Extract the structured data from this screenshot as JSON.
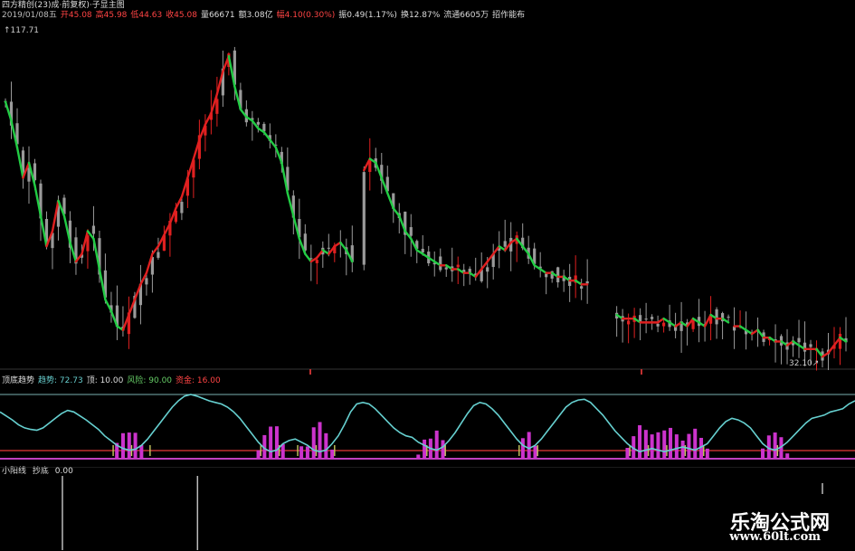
{
  "header": {
    "line1": "四方精创(23)成·前复权)·子显主图",
    "line2": [
      {
        "text": "2019/01/08五",
        "color": "#bbbbbb"
      },
      {
        "text": "开45.08",
        "color": "#ff4444"
      },
      {
        "text": "高45.98",
        "color": "#ff4444"
      },
      {
        "text": "低44.63",
        "color": "#ff4444"
      },
      {
        "text": "收45.08",
        "color": "#ff4444"
      },
      {
        "text": "量66671",
        "color": "#dddddd"
      },
      {
        "text": "额3.08亿",
        "color": "#dddddd"
      },
      {
        "text": "幅4.10(0.30%)",
        "color": "#ff4444"
      },
      {
        "text": "振0.49(1.17%)",
        "color": "#dddddd"
      },
      {
        "text": "换12.87%",
        "color": "#dddddd"
      },
      {
        "text": "流通6605万",
        "color": "#dddddd"
      },
      {
        "text": "招作能布",
        "color": "#dddddd"
      }
    ]
  },
  "main_chart": {
    "max_label": "117.71",
    "min_label": "32.10"
  },
  "osc_panel": {
    "labels": [
      {
        "text": "顶底趋势",
        "color": "#dddddd"
      },
      {
        "text": "趋势: 72.73",
        "color": "#66cccc"
      },
      {
        "text": "顶: 10.00",
        "color": "#dddddd"
      },
      {
        "text": "风险: 90.00",
        "color": "#66cc66"
      },
      {
        "text": "资金: 16.00",
        "color": "#ff4444"
      }
    ]
  },
  "bottom_panel": {
    "title": "小阳线",
    "label": "抄底",
    "value": "0.00"
  },
  "watermark": {
    "line1": "乐淘公式网",
    "line2": "www.60lt.com"
  },
  "colors": {
    "up": "#e02020",
    "down": "#22cc44",
    "candle_gray": "#9a9a9a",
    "osc_line": "#66d0d0",
    "magenta": "#cc33cc",
    "band_top": "#7ab0b0",
    "band_red": "#c03030",
    "band_magenta": "#c040c0"
  },
  "chart_data": {
    "type": "line",
    "title": "四方精创",
    "y_range": [
      32.1,
      117.71
    ],
    "price_close": [
      100,
      95,
      88,
      80,
      84,
      78,
      70,
      62,
      66,
      74,
      70,
      63,
      58,
      60,
      66,
      64,
      56,
      48,
      45,
      41,
      40,
      44,
      48,
      52,
      55,
      60,
      62,
      65,
      68,
      72,
      75,
      80,
      85,
      90,
      94,
      97,
      102,
      108,
      112,
      104,
      98,
      96,
      95,
      93,
      92,
      90,
      88,
      84,
      76,
      70,
      64,
      60,
      58,
      59,
      61,
      60,
      62,
      63,
      61,
      58,
      56,
      82,
      85,
      84,
      80,
      76,
      72,
      70,
      66,
      64,
      61,
      60,
      59,
      58,
      57,
      57,
      56,
      56,
      55,
      55,
      54,
      56,
      58,
      60,
      62,
      61,
      63,
      64,
      62,
      60,
      57,
      56,
      55,
      55,
      54,
      54,
      53,
      53,
      52,
      52,
      46,
      45,
      45,
      44,
      44,
      43,
      43,
      43,
      42,
      42,
      42,
      42,
      43,
      42,
      41,
      42,
      41,
      43,
      42,
      41,
      44,
      43,
      43,
      42,
      41,
      41,
      40,
      39,
      40,
      38,
      38,
      37,
      37,
      36,
      37,
      36,
      35,
      35,
      35,
      33,
      34,
      36,
      38,
      37
    ],
    "oscillator": [
      60,
      55,
      50,
      44,
      40,
      38,
      37,
      40,
      46,
      52,
      58,
      62,
      60,
      55,
      50,
      44,
      38,
      30,
      24,
      18,
      14,
      12,
      13,
      18,
      26,
      36,
      46,
      56,
      66,
      74,
      80,
      82,
      80,
      77,
      74,
      72,
      70,
      66,
      60,
      52,
      42,
      32,
      22,
      14,
      10,
      12,
      20,
      24,
      26,
      22,
      18,
      12,
      10,
      12,
      20,
      30,
      44,
      60,
      70,
      72,
      70,
      64,
      56,
      48,
      40,
      34,
      30,
      28,
      22,
      18,
      14,
      12,
      16,
      24,
      34,
      46,
      58,
      68,
      72,
      70,
      64,
      56,
      46,
      36,
      26,
      18,
      14,
      18,
      26,
      36,
      46,
      56,
      66,
      72,
      75,
      76,
      72,
      64,
      56,
      46,
      36,
      28,
      20,
      14,
      10,
      12,
      14,
      12,
      10,
      12,
      14,
      16,
      14,
      12,
      16,
      20,
      30,
      40,
      48,
      52,
      50,
      46,
      40,
      30,
      20,
      14,
      12,
      16,
      22,
      30,
      38,
      46,
      52,
      54,
      56,
      60,
      62,
      64,
      70,
      74
    ],
    "signal_spikes": [
      {
        "x": 0.073,
        "h": 1.0
      },
      {
        "x": 0.231,
        "h": 1.0
      }
    ]
  }
}
